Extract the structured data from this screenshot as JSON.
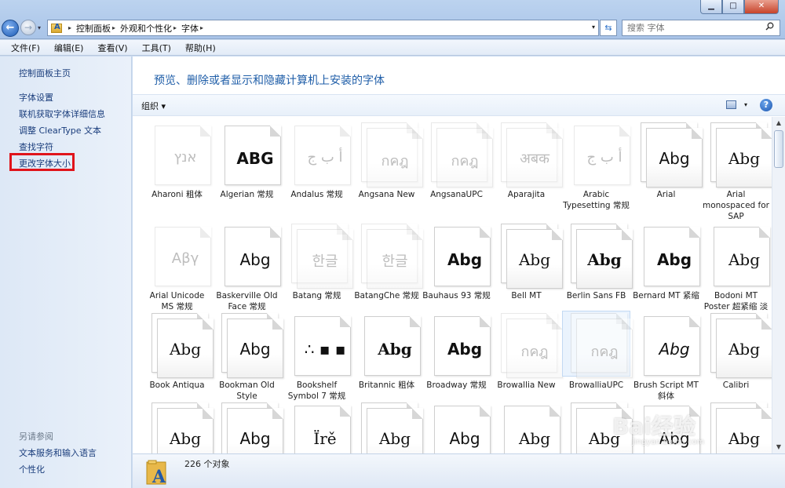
{
  "window": {
    "min_glyph": "▁",
    "max_glyph": "□",
    "close_glyph": "✕"
  },
  "nav": {
    "back_glyph": "←",
    "forward_glyph": "→",
    "dropdown_glyph": "▾"
  },
  "address": {
    "separator": "▸",
    "breadcrumbs": [
      "控制面板",
      "外观和个性化",
      "字体"
    ],
    "dropdown_glyph": "▾",
    "refresh_glyph": "⇆"
  },
  "search": {
    "placeholder": "搜索 字体"
  },
  "menubar": {
    "items": [
      "文件(F)",
      "编辑(E)",
      "查看(V)",
      "工具(T)",
      "帮助(H)"
    ]
  },
  "sidebar": {
    "home": "控制面板主页",
    "links": [
      "字体设置",
      "联机获取字体详细信息",
      "调整 ClearType 文本",
      "查找字符",
      "更改字体大小"
    ],
    "see_also_title": "另请参阅",
    "see_also": [
      "文本服务和输入语言",
      "个性化"
    ]
  },
  "main": {
    "title": "预览、删除或者显示和隐藏计算机上安装的字体",
    "organize": "组织",
    "organize_glyph": "▾",
    "help_glyph": "?"
  },
  "fonts": [
    {
      "name": "Aharoni 粗体",
      "sample": "אנץ",
      "stacked": false,
      "faded": true
    },
    {
      "name": "Algerian 常规",
      "sample": "ABG",
      "stacked": false,
      "faded": false
    },
    {
      "name": "Andalus 常规",
      "sample": "أ ب ج",
      "stacked": false,
      "faded": true
    },
    {
      "name": "Angsana New",
      "sample": "กคฎ",
      "stacked": true,
      "faded": true
    },
    {
      "name": "AngsanaUPC",
      "sample": "กคฎ",
      "stacked": true,
      "faded": true
    },
    {
      "name": "Aparajita",
      "sample": "अबक",
      "stacked": true,
      "faded": true
    },
    {
      "name": "Arabic Typesetting 常规",
      "sample": "أ ب ج",
      "stacked": false,
      "faded": true
    },
    {
      "name": "Arial",
      "sample": "Abg",
      "stacked": true,
      "faded": false
    },
    {
      "name": "Arial monospaced for SAP",
      "sample": "Abg",
      "stacked": true,
      "faded": false
    },
    {
      "name": "Arial Unicode MS 常规",
      "sample": "Αβγ",
      "stacked": false,
      "faded": true
    },
    {
      "name": "Baskerville Old Face 常规",
      "sample": "Abg",
      "stacked": false,
      "faded": false
    },
    {
      "name": "Batang 常规",
      "sample": "한글",
      "stacked": true,
      "faded": true
    },
    {
      "name": "BatangChe 常规",
      "sample": "한글",
      "stacked": true,
      "faded": true
    },
    {
      "name": "Bauhaus 93 常规",
      "sample": "Abg",
      "stacked": false,
      "faded": false
    },
    {
      "name": "Bell MT",
      "sample": "Abg",
      "stacked": true,
      "faded": false
    },
    {
      "name": "Berlin Sans FB",
      "sample": "Abg",
      "stacked": true,
      "faded": false
    },
    {
      "name": "Bernard MT 紧缩",
      "sample": "Abg",
      "stacked": false,
      "faded": false
    },
    {
      "name": "Bodoni MT Poster 超紧缩 淡",
      "sample": "Abg",
      "stacked": false,
      "faded": false
    },
    {
      "name": "Book Antiqua",
      "sample": "Abg",
      "stacked": true,
      "faded": false
    },
    {
      "name": "Bookman Old Style",
      "sample": "Abg",
      "stacked": true,
      "faded": false
    },
    {
      "name": "Bookshelf Symbol 7 常规",
      "sample": "∴ ▪ ▪",
      "stacked": false,
      "faded": false
    },
    {
      "name": "Britannic 粗体",
      "sample": "Abg",
      "stacked": false,
      "faded": false
    },
    {
      "name": "Broadway 常规",
      "sample": "Abg",
      "stacked": false,
      "faded": false
    },
    {
      "name": "Browallia New",
      "sample": "กคฎ",
      "stacked": true,
      "faded": true
    },
    {
      "name": "BrowalliaUPC",
      "sample": "กคฎ",
      "stacked": true,
      "faded": true
    },
    {
      "name": "Brush Script MT 斜体",
      "sample": "Abg",
      "stacked": false,
      "faded": false
    },
    {
      "name": "Calibri",
      "sample": "Abg",
      "stacked": true,
      "faded": false
    },
    {
      "name": "",
      "sample": "Abg",
      "stacked": true,
      "faded": false
    },
    {
      "name": "",
      "sample": "Abg",
      "stacked": true,
      "faded": false
    },
    {
      "name": "",
      "sample": "Ïrě",
      "stacked": false,
      "faded": false
    },
    {
      "name": "",
      "sample": "Abg",
      "stacked": true,
      "faded": false
    },
    {
      "name": "",
      "sample": "Abg",
      "stacked": false,
      "faded": false
    },
    {
      "name": "",
      "sample": "Abg",
      "stacked": false,
      "faded": false
    },
    {
      "name": "",
      "sample": "Abg",
      "stacked": true,
      "faded": false
    },
    {
      "name": "",
      "sample": "Abg",
      "stacked": false,
      "faded": false
    },
    {
      "name": "",
      "sample": "Abg",
      "stacked": true,
      "faded": false
    }
  ],
  "selected_font": "BrowalliaUPC",
  "status": {
    "count": "226 个对象"
  },
  "scrollbar": {
    "up_glyph": "▲",
    "down_glyph": "▼"
  },
  "watermark": {
    "logo": "Bai经验",
    "url": "jingyan.baidu.com"
  },
  "colors": {
    "highlight_border": "#e0141b",
    "title_blue": "#1f5ea8",
    "link_blue": "#1a3d7c"
  }
}
